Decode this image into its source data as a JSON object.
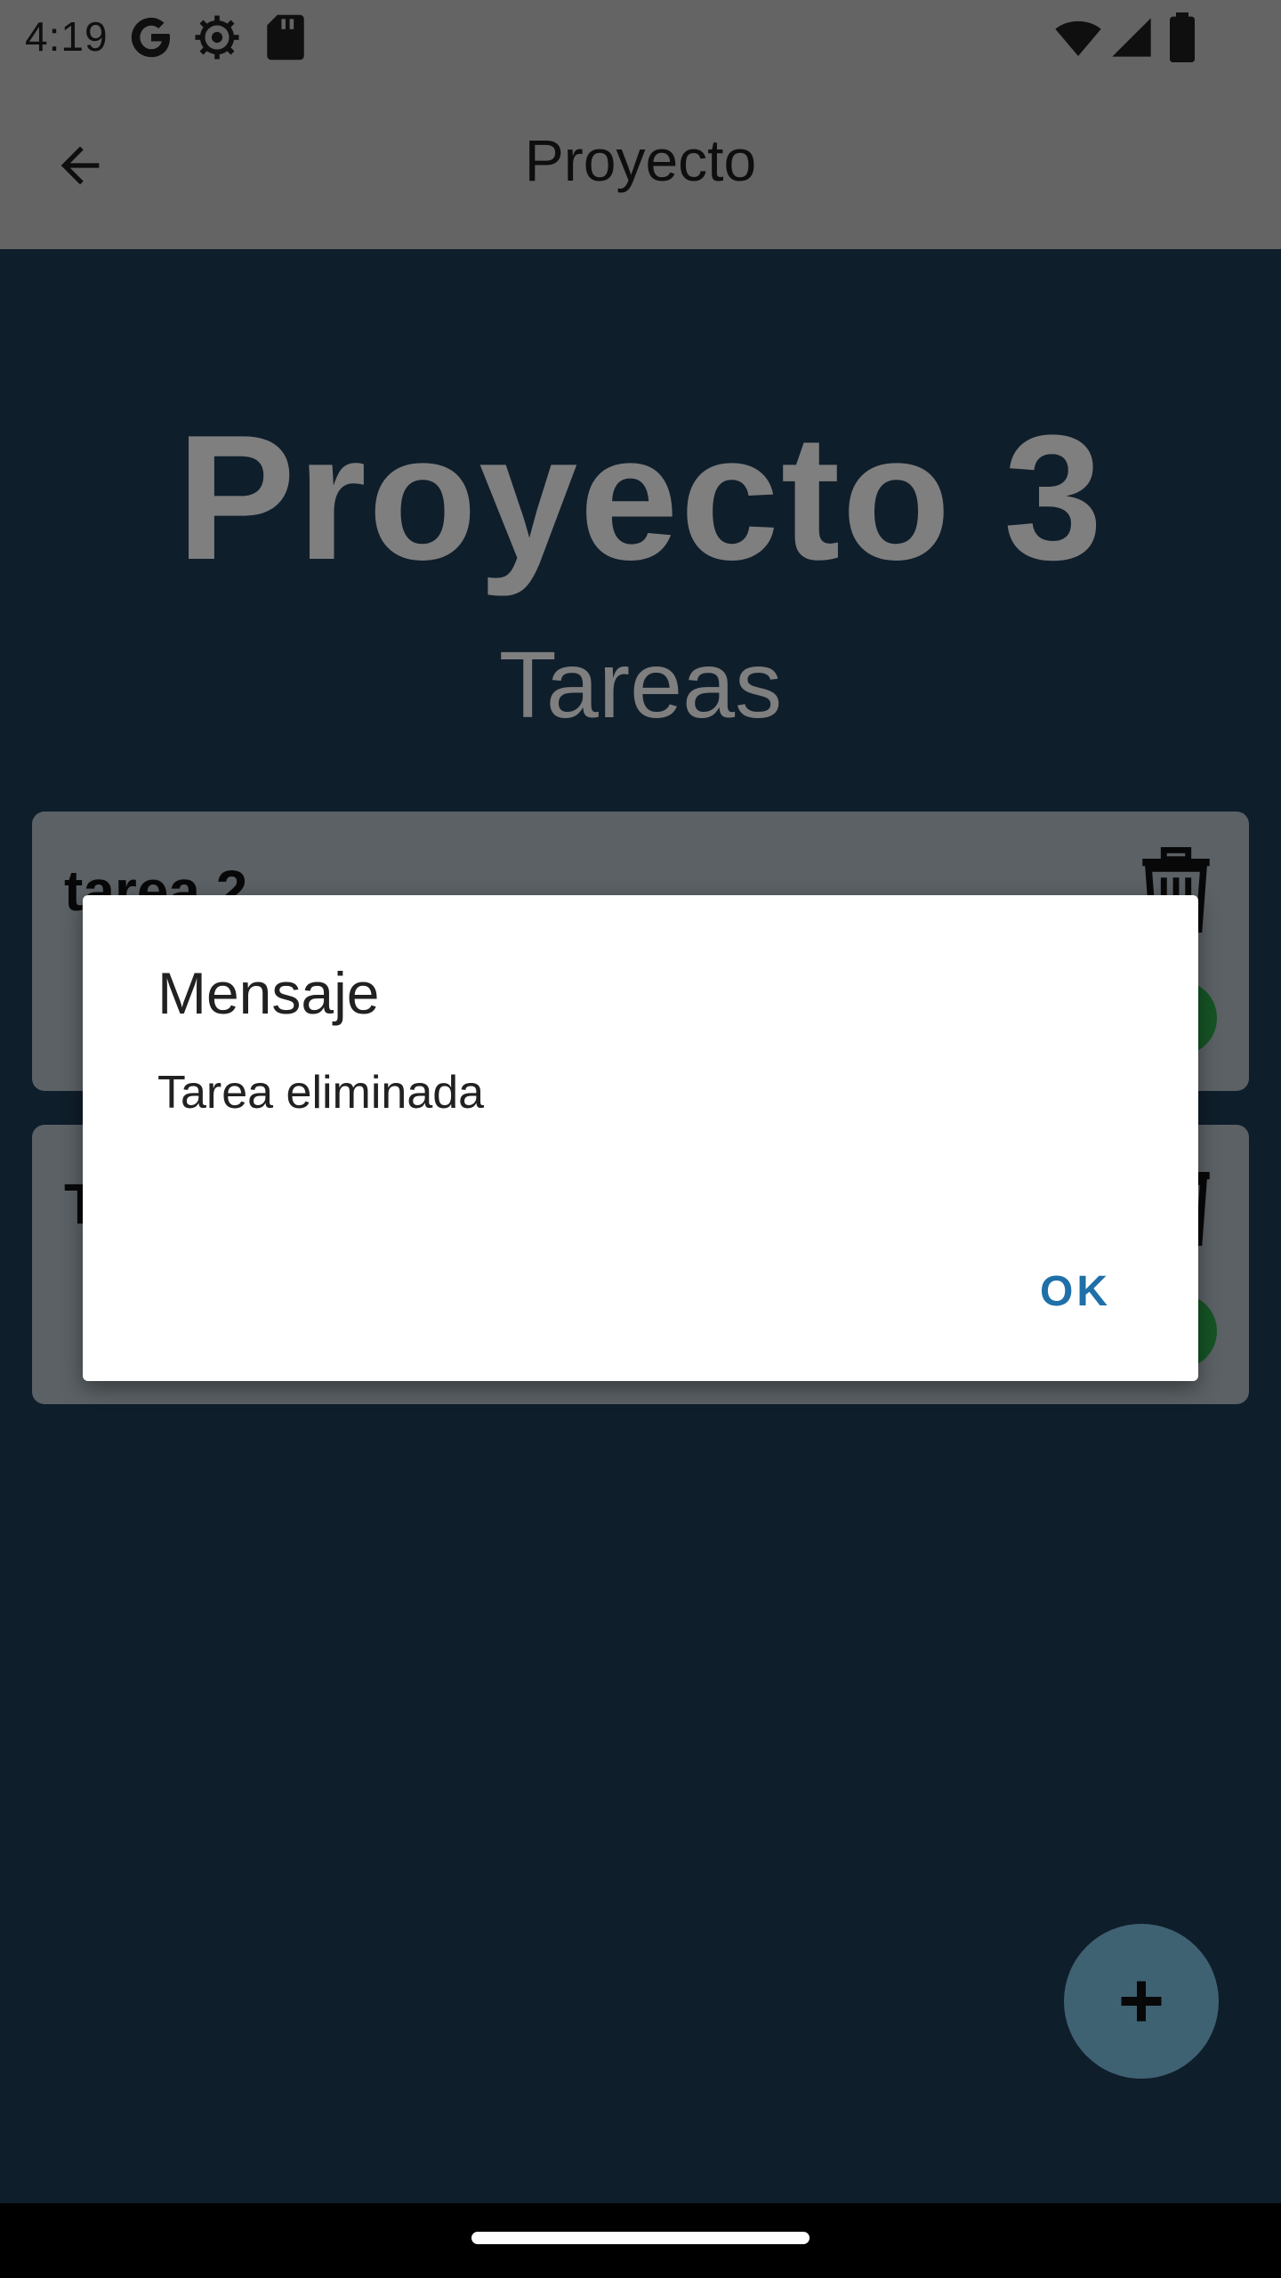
{
  "status_bar": {
    "time": "4:19"
  },
  "app_bar": {
    "title": "Proyecto"
  },
  "main": {
    "project_title": "Proyecto 3",
    "section_subtitle": "Tareas",
    "tasks": [
      {
        "name": "tarea 2"
      },
      {
        "name": "T"
      }
    ]
  },
  "dialog": {
    "title": "Mensaje",
    "message": "Tarea eliminada",
    "ok_label": "OK"
  },
  "colors": {
    "accent": "#1f6fa8",
    "background": "#1e3c57",
    "fab": "#7fc5e6",
    "check": "#2aa84a"
  }
}
